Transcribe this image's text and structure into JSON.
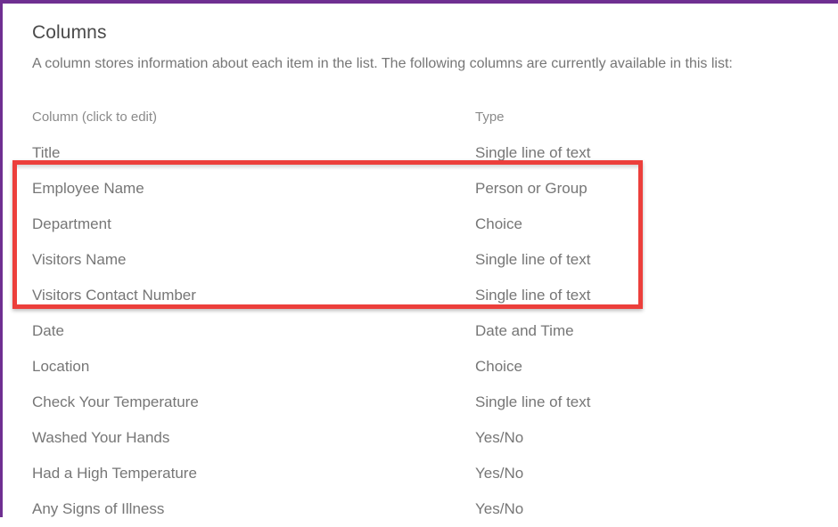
{
  "theme": {
    "frame_accent": "#6f2f91",
    "highlight_color": "#ec3f3b",
    "text_color": "#767676",
    "title_color": "#4a4a4a"
  },
  "page": {
    "title": "Columns",
    "description": "A column stores information about each item in the list. The following columns are currently available in this list:"
  },
  "table": {
    "headers": {
      "name": "Column (click to edit)",
      "type": "Type"
    },
    "rows": [
      {
        "name": "Title",
        "type": "Single line of text",
        "highlighted": false
      },
      {
        "name": "Employee Name",
        "type": "Person or Group",
        "highlighted": true
      },
      {
        "name": "Department",
        "type": "Choice",
        "highlighted": true
      },
      {
        "name": "Visitors Name",
        "type": "Single line of text",
        "highlighted": true
      },
      {
        "name": "Visitors Contact Number",
        "type": "Single line of text",
        "highlighted": true
      },
      {
        "name": "Date",
        "type": "Date and Time",
        "highlighted": false
      },
      {
        "name": "Location",
        "type": "Choice",
        "highlighted": false
      },
      {
        "name": "Check Your Temperature",
        "type": "Single line of text",
        "highlighted": false
      },
      {
        "name": "Washed Your Hands",
        "type": "Yes/No",
        "highlighted": false
      },
      {
        "name": "Had a High Temperature",
        "type": "Yes/No",
        "highlighted": false
      },
      {
        "name": "Any Signs of Illness",
        "type": "Yes/No",
        "highlighted": false
      }
    ]
  },
  "annotation": {
    "shape": "rectangle",
    "label": "highlighted-columns-callout"
  }
}
